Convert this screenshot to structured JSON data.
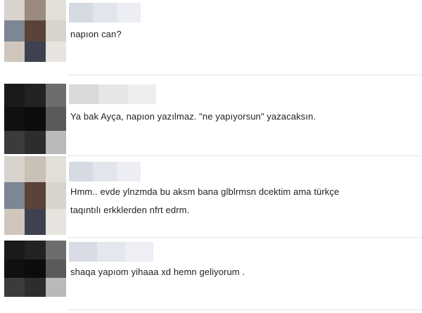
{
  "comments": [
    {
      "text": "napıon can?"
    },
    {
      "text": "Ya bak Ayça, napıon yazılmaz. \"ne yapıyorsun\" yazacaksın."
    },
    {
      "text_line1": "Hmm.. evde ylnzmda bu aksm bana glblrmsn dcektim ama türkçe",
      "text_line2": "taqıntılı erkklerden nfrt edrm."
    },
    {
      "text": "shaqa yapıom yihaaa xd hemn geliyorum ."
    }
  ]
}
